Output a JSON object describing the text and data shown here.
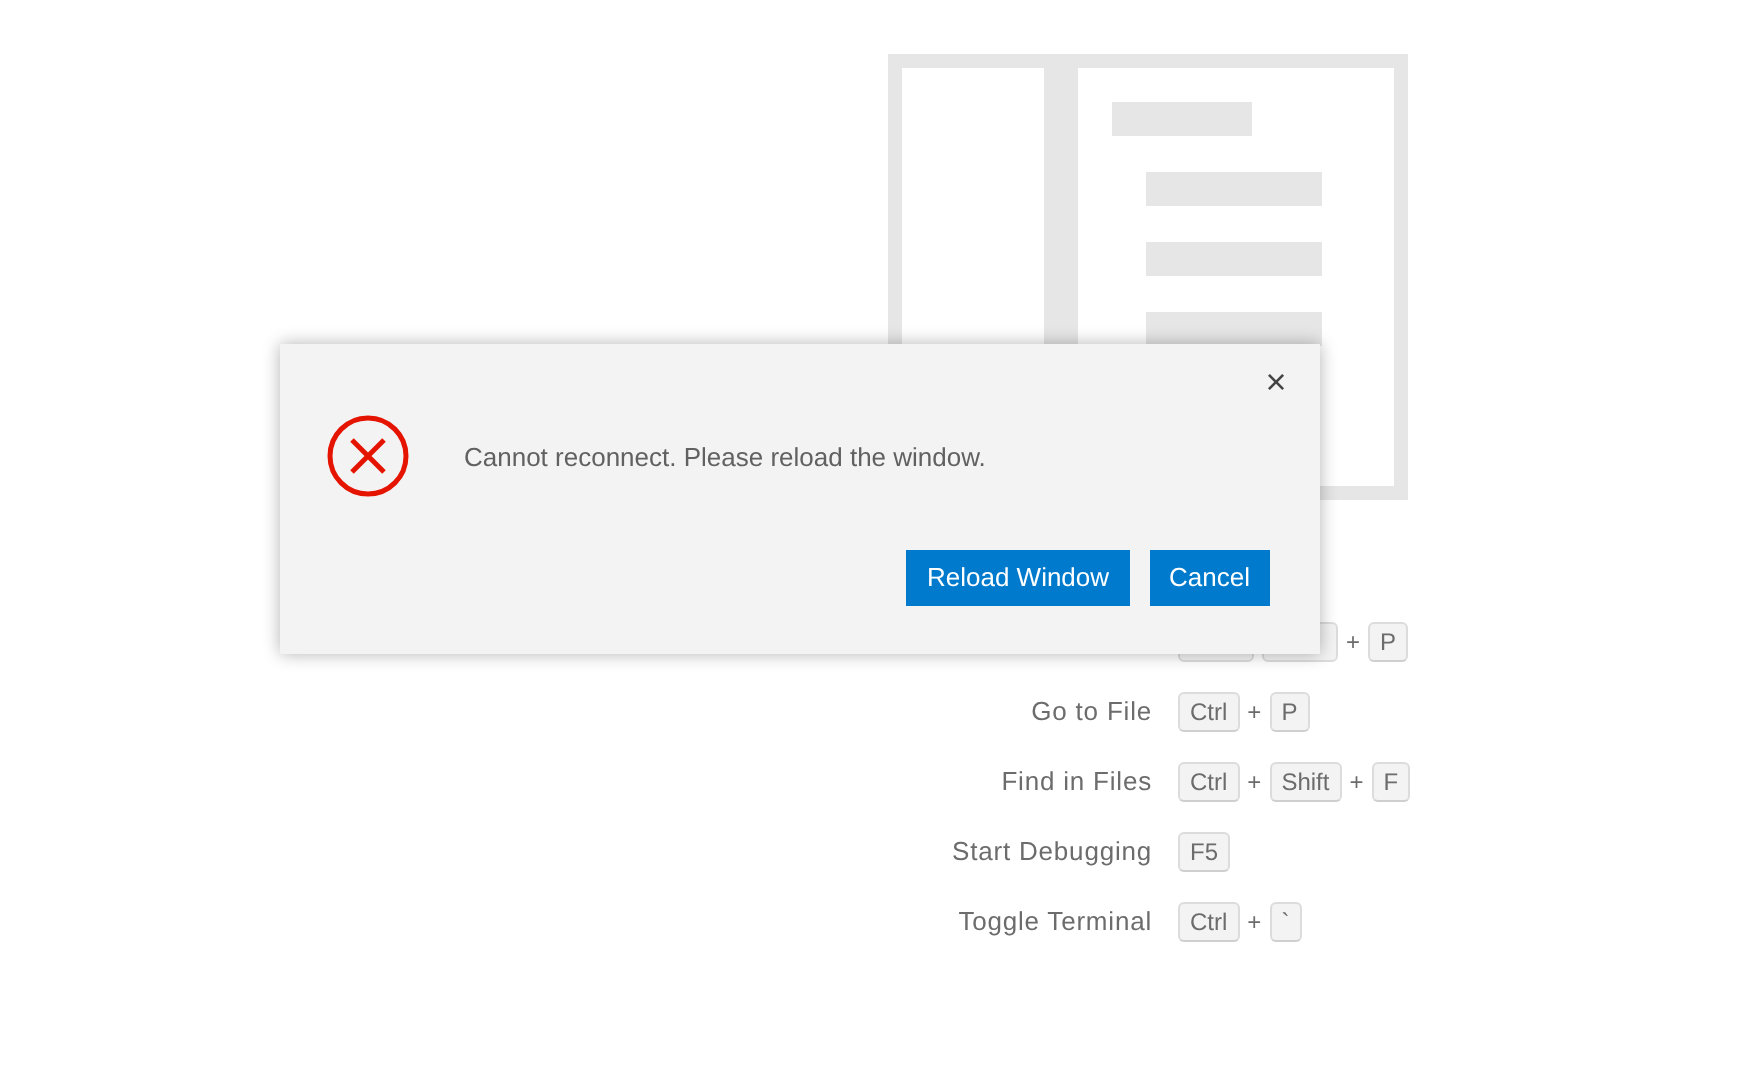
{
  "shortcuts": [
    {
      "items": [
        {
          "kind": "plus",
          "text": "+"
        },
        {
          "kind": "key",
          "text": "P"
        }
      ]
    },
    {
      "label": "Go to File",
      "items": [
        {
          "kind": "key",
          "text": "Ctrl"
        },
        {
          "kind": "plus",
          "text": "+"
        },
        {
          "kind": "key",
          "text": "P"
        }
      ]
    },
    {
      "label": "Find in Files",
      "items": [
        {
          "kind": "key",
          "text": "Ctrl"
        },
        {
          "kind": "plus",
          "text": "+"
        },
        {
          "kind": "key",
          "text": "Shift"
        },
        {
          "kind": "plus",
          "text": "+"
        },
        {
          "kind": "key",
          "text": "F"
        }
      ]
    },
    {
      "label": "Start Debugging",
      "items": [
        {
          "kind": "key",
          "text": "F5"
        }
      ]
    },
    {
      "label": "Toggle Terminal",
      "items": [
        {
          "kind": "key",
          "text": "Ctrl"
        },
        {
          "kind": "plus",
          "text": "+"
        },
        {
          "kind": "key",
          "text": "`"
        }
      ]
    }
  ],
  "dialog": {
    "message": "Cannot reconnect. Please reload the window.",
    "close": "×",
    "buttons": [
      "Reload Window",
      "Cancel"
    ]
  }
}
